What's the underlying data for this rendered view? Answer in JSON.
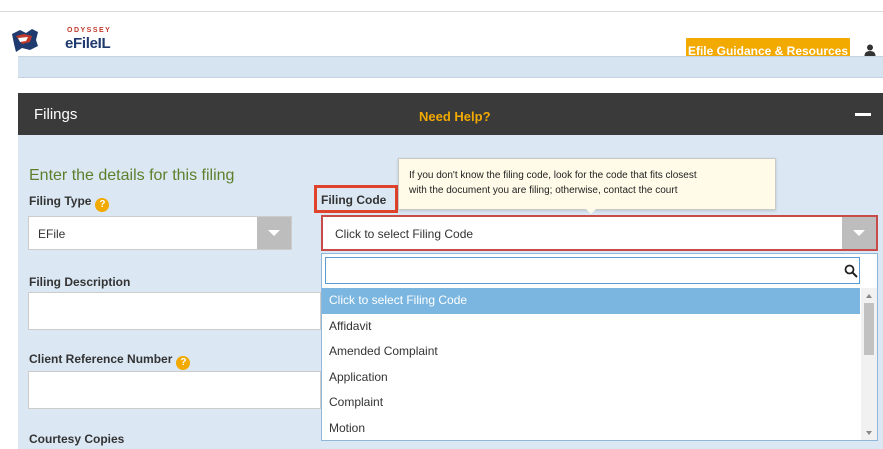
{
  "header": {
    "logo_brand": "ODYSSEY",
    "logo_name": "eFileIL",
    "guidance_button": "Efile Guidance & Resources",
    "user_icon": "user-icon"
  },
  "panel": {
    "title": "Filings",
    "need_help": "Need Help?",
    "collapse_icon": "minus-icon"
  },
  "form": {
    "intro": "Enter the details for this filing",
    "filing_type_label": "Filing Type",
    "filing_type_value": "EFile",
    "filing_description_label": "Filing Description",
    "client_reference_label": "Client Reference Number",
    "courtesy_copies_label": "Courtesy Copies",
    "help_glyph": "?",
    "filing_code_label": "Filing Code",
    "filing_code_value": "Click to select Filing Code",
    "tooltip_line1": "If you don't know the filing code, look for the code that fits closest",
    "tooltip_line2": "with the document you are filing; otherwise, contact the court"
  },
  "dropdown": {
    "search_value": "",
    "options": [
      "Click to select Filing Code",
      "Affidavit",
      "Amended Complaint",
      "Application",
      "Complaint",
      "Motion"
    ],
    "selected_index": 0
  },
  "colors": {
    "accent": "#f2a900",
    "panel_header": "#3a3a3a",
    "panel_bg": "#dbe8f4",
    "highlight_red": "#e0432b",
    "selected_option": "#7ab6e0",
    "intro_green": "#5e7f2a"
  }
}
